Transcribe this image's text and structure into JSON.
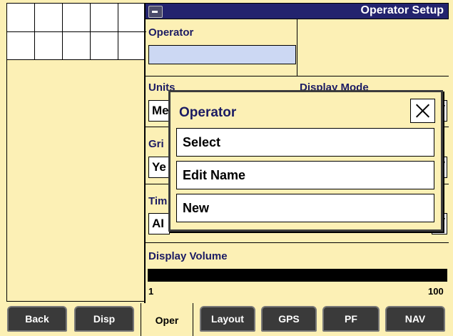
{
  "header": {
    "title": "Operator Setup",
    "icon": "monitor-icon"
  },
  "operator": {
    "label": "Operator",
    "value": ""
  },
  "units": {
    "label": "Units",
    "value": "Me"
  },
  "display_mode": {
    "label": "Display Mode"
  },
  "grid": {
    "label": "Gri",
    "value": "Ye"
  },
  "time": {
    "label": "Tim",
    "value": "AI"
  },
  "display_volume": {
    "label": "Display Volume",
    "min": "1",
    "max": "100",
    "level_fraction": 1.0
  },
  "dialog": {
    "title": "Operator",
    "options": [
      "Select",
      "Edit Name",
      "New"
    ]
  },
  "tabs": [
    {
      "label": "Back",
      "active": false
    },
    {
      "label": "Disp",
      "active": false
    },
    {
      "label": "Oper",
      "active": true
    },
    {
      "label": "Layout",
      "active": false
    },
    {
      "label": "GPS",
      "active": false
    },
    {
      "label": "PF",
      "active": false
    },
    {
      "label": "NAV",
      "active": false
    }
  ],
  "colors": {
    "header_bg": "#23236e",
    "panel_bg": "#fcf0b5",
    "field_bg": "#ccd8f3",
    "tab_bg": "#3a3a3a"
  }
}
